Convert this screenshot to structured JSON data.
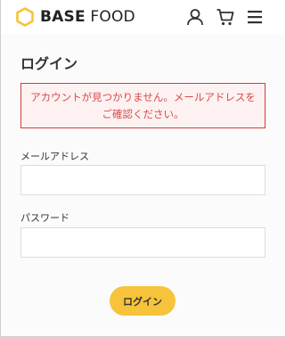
{
  "header": {
    "logo_bold": "BASE",
    "logo_light": "FOOD",
    "brand_color": "#f6c33a",
    "icons": [
      "user-icon",
      "cart-icon",
      "hamburger-menu-icon"
    ]
  },
  "main": {
    "title": "ログイン",
    "error_message": "アカウントが見つかりません。メールアドレスをご確認ください。",
    "email_label": "メールアドレス",
    "email_value": "",
    "password_label": "パスワード",
    "password_value": "",
    "login_button": "ログイン",
    "error_color": "#d23b3b"
  }
}
